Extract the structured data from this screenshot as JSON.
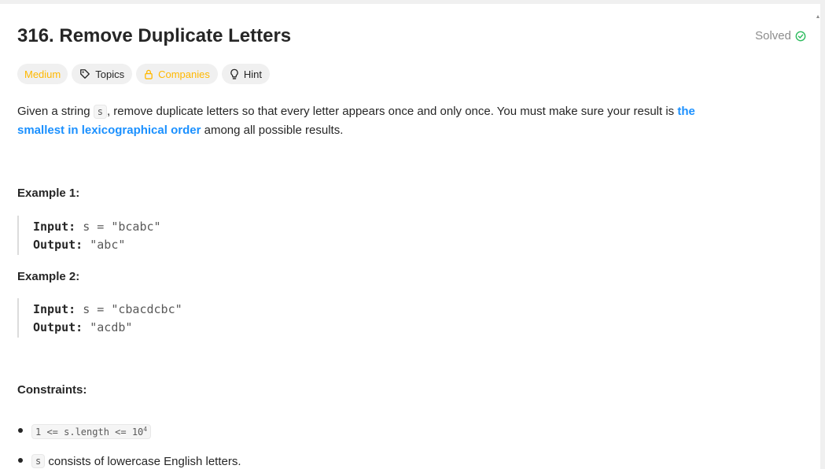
{
  "problem": {
    "title": "316. Remove Duplicate Letters",
    "status": "Solved",
    "colors": {
      "solved_check": "#2cbb5d",
      "difficulty": "#ffb800",
      "link": "#1a90ff"
    }
  },
  "tags": {
    "difficulty": "Medium",
    "topics": "Topics",
    "companies": "Companies",
    "hint": "Hint",
    "icons": {
      "topics": "tag-icon",
      "companies": "lock-icon",
      "hint": "lightbulb-icon",
      "status": "check-circle-icon"
    }
  },
  "description": {
    "part1": "Given a string ",
    "var_s": "s",
    "part2": ", remove duplicate letters so that every letter appears once and only once. You must make sure your result is ",
    "link_text": "the smallest in lexicographical order",
    "part3": " among all possible results."
  },
  "examples": [
    {
      "heading": "Example 1:",
      "input_label": "Input:",
      "input_value": "s = \"bcabc\"",
      "output_label": "Output:",
      "output_value": "\"abc\""
    },
    {
      "heading": "Example 2:",
      "input_label": "Input:",
      "input_value": "s = \"cbacdcbc\"",
      "output_label": "Output:",
      "output_value": "\"acdb\""
    }
  ],
  "constraints": {
    "heading": "Constraints:",
    "c1_code": "1 <= s.length <= 10",
    "c1_sup": "4",
    "c2_code": "s",
    "c2_text": " consists of lowercase English letters."
  }
}
